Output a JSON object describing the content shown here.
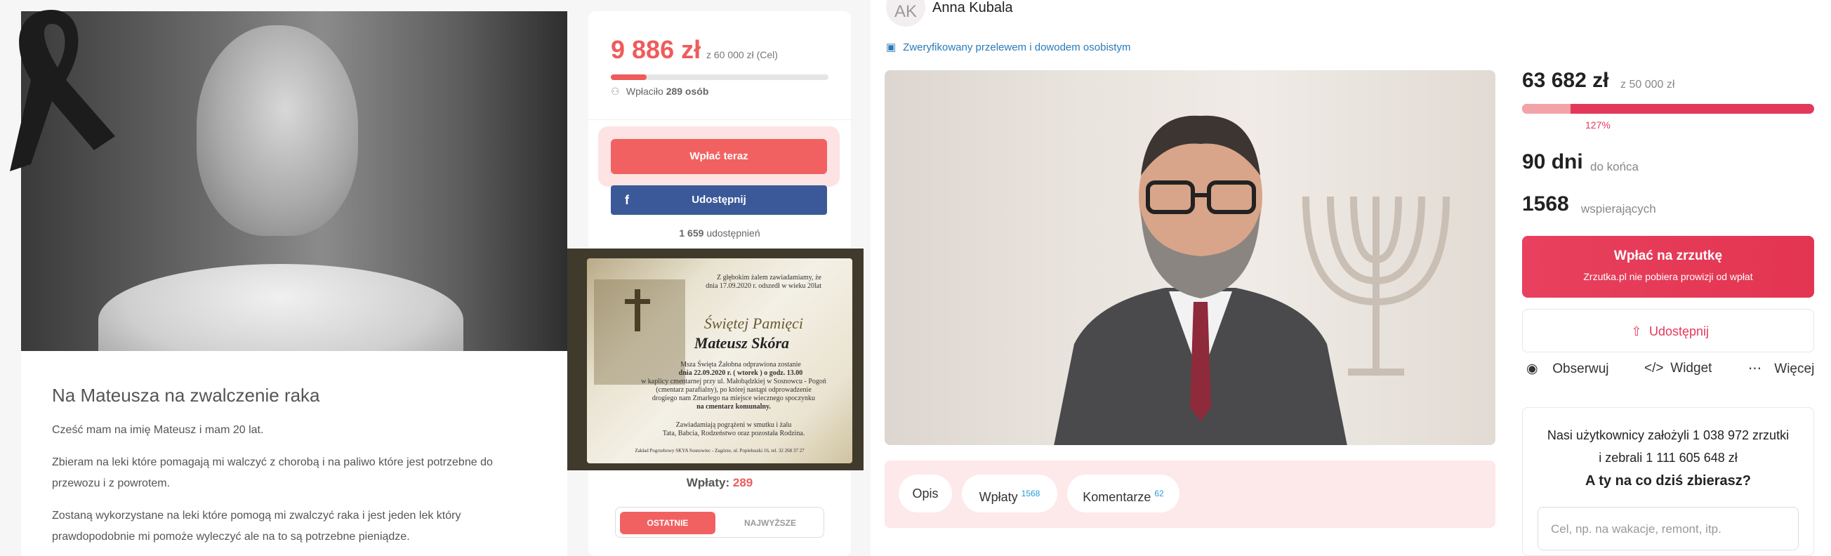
{
  "left": {
    "campaign_title": "Na Mateusza na zwalczenie raka",
    "paragraphs": [
      "Cześć mam na imię Mateusz i mam 20 lat.",
      "Zbieram na leki które pomagają mi walczyć z chorobą i na paliwo które jest potrzebne do przewozu i z powrotem.",
      "Zostaną wykorzystane na leki które pomogą mi zwalczyć raka i jest jeden lek który prawdopodobnie mi pomoże wyleczyć ale na to są potrzebne pieniądze."
    ],
    "amount": "9 886 zł",
    "goal": "z 60 000 zł (Cel)",
    "progress_fraction": 0.165,
    "paid_prefix": "Wpłaciło",
    "paid_count": "289 osób",
    "pay_button": "Wpłać teraz",
    "share_button": "Udostępnij",
    "shares_count": "1 659",
    "shares_label": "udostępnień",
    "obituary": {
      "l1": "Z głębokim żalem zawiadamiamy, że",
      "l2": "dnia 17.09.2020 r. odszedł w wieku 20lat",
      "heading1": "Świętej Pamięci",
      "heading2": "Mateusz Skóra",
      "l3": "Msza Święta Żałobna odprawiona zostanie",
      "l4": "dnia 22.09.2020 r. ( wtorek ) o godz. 13.00",
      "l5": "w kaplicy cmentarnej przy ul. Małobądzkiej w Sosnowcu - Pogoń",
      "l6": "(cmentarz parafialny), po której nastąpi odprowadzenie",
      "l7": "drogiego nam Zmarłego na miejsce wiecznego spoczynku",
      "l8": "na cmentarz komunalny.",
      "l9": "Zawiadamiają pogrążeni w smutku i żalu",
      "l10": "Tata, Babcia, Rodzeństwo oraz pozostała Rodzina.",
      "footer": "Zakład Pogrzebowy SKYA Sosnowiec - Zagórze, ul. Popiełuszki 16, tel. 32 268 37 27"
    },
    "payments_label": "Wpłaty:",
    "payments_count": "289",
    "tab_latest": "OSTATNIE",
    "tab_highest": "NAJWYŻSZE"
  },
  "right": {
    "avatar_initials": "AK",
    "author": "Anna Kubala",
    "verified": "Zweryfikowany przelewem i dowodem osobistym",
    "tab_description": "Opis",
    "tab_payments": "Wpłaty",
    "tab_payments_count": "1568",
    "tab_comments": "Komentarze",
    "tab_comments_count": "62",
    "amount": "63 682 zł",
    "goal": "z 50 000 zł",
    "progress_fraction": 0.165,
    "percent": "127%",
    "days": "90 dni",
    "days_label": "do końca",
    "supporters": "1568",
    "supporters_label": "wspierających",
    "pay_button": "Wpłać na zrzutkę",
    "pay_sub": "Zrzutka.pl nie pobiera prowizji od wpłat",
    "share_button": "Udostępnij",
    "action_watch": "Obserwuj",
    "action_widget": "Widget",
    "action_more": "Więcej",
    "info_line1": "Nasi użytkownicy założyli 1 038 972 zrzutki",
    "info_line2": "i zebrali 1 111 605 648 zł",
    "info_question": "A ty na co dziś zbierasz?",
    "input_placeholder": "Cel, np. na wakacje, remont, itp."
  }
}
